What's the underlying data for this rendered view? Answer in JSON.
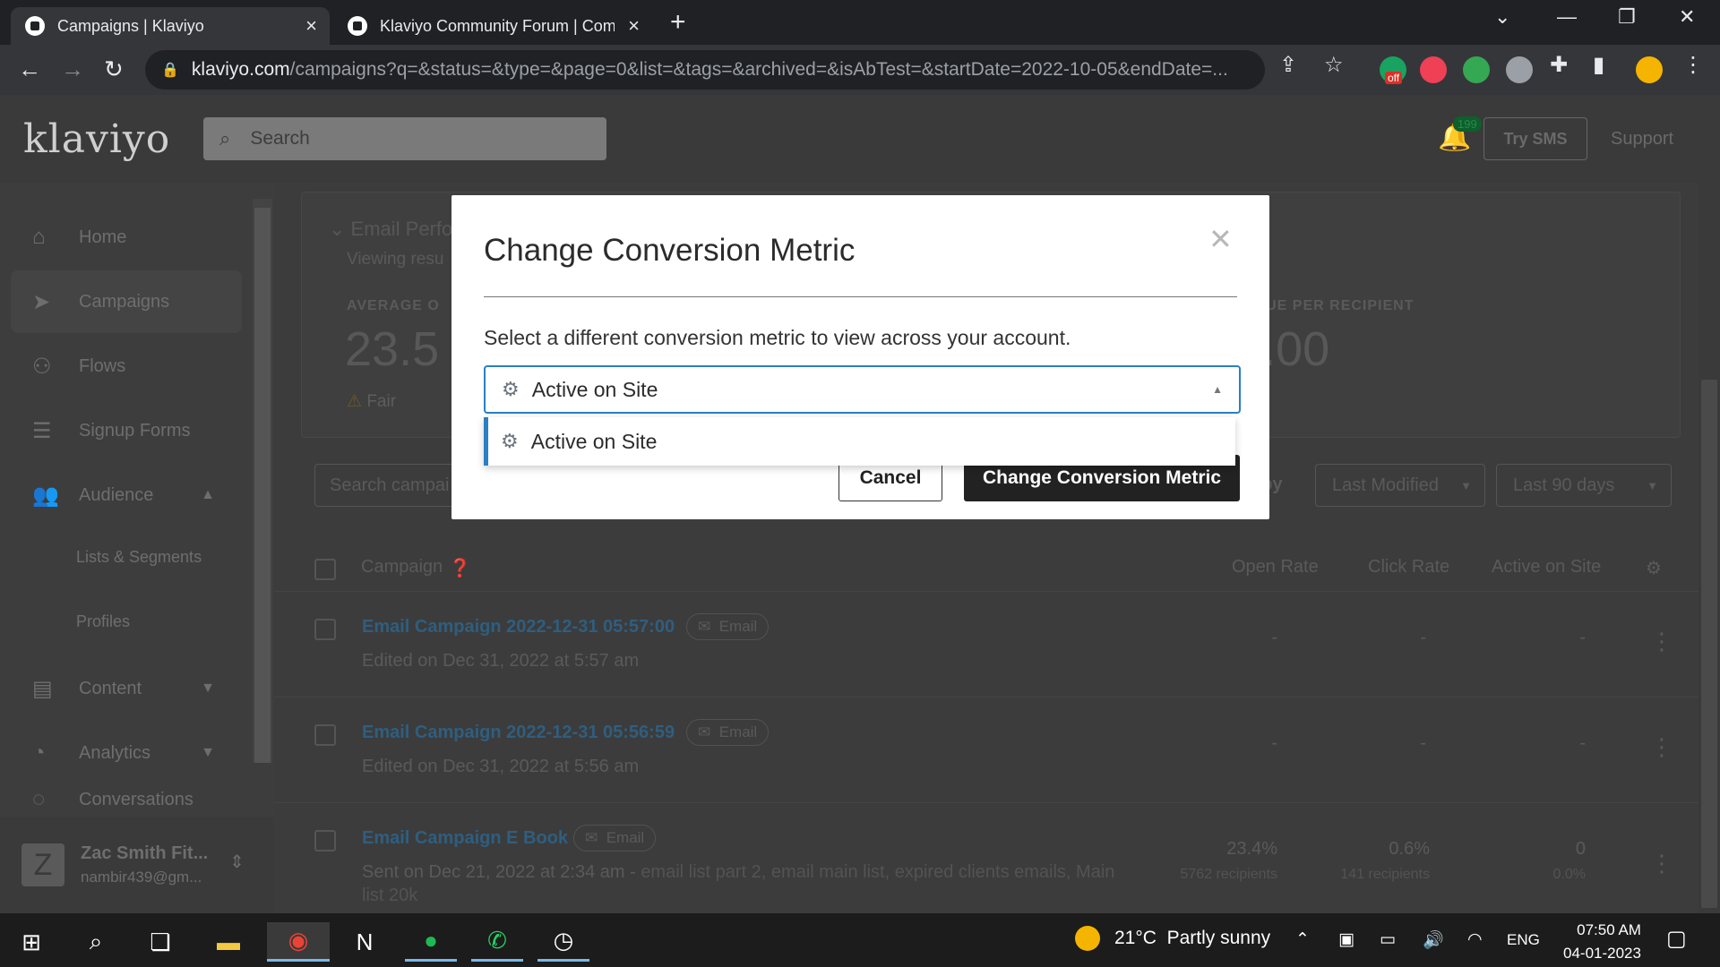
{
  "browser": {
    "tabs": [
      {
        "title": "Campaigns | Klaviyo",
        "active": true
      },
      {
        "title": "Klaviyo Community Forum | Com",
        "active": false
      }
    ],
    "url_host": "klaviyo.com",
    "url_path": "/campaigns?q=&status=&type=&page=0&list=&tags=&archived=&isAbTest=&startDate=2022-10-05&endDate=...",
    "extension_badge": "off"
  },
  "header": {
    "logo": "klaviyo",
    "search_placeholder": "Search",
    "notification_count": "199",
    "try_sms": "Try SMS",
    "support": "Support"
  },
  "sidebar": {
    "items": [
      {
        "label": "Home",
        "icon": "home-icon"
      },
      {
        "label": "Campaigns",
        "icon": "campaigns-icon",
        "active": true
      },
      {
        "label": "Flows",
        "icon": "flows-icon"
      },
      {
        "label": "Signup Forms",
        "icon": "signup-forms-icon"
      },
      {
        "label": "Audience",
        "icon": "audience-icon"
      },
      {
        "label": "Content",
        "icon": "content-icon"
      },
      {
        "label": "Analytics",
        "icon": "analytics-icon"
      },
      {
        "label": "Conversations",
        "icon": "conversations-icon"
      }
    ],
    "sub_items": [
      "Lists & Segments",
      "Profiles"
    ],
    "account": {
      "initial": "Z",
      "name": "Zac Smith Fit...",
      "email": "nambir439@gm..."
    }
  },
  "performance": {
    "title": "Email Perfo",
    "subtitle": "Viewing resu",
    "avg_label": "AVERAGE O",
    "avg_value": "23.5",
    "avg_note": "Fair",
    "rpr_label": "REVENUE PER RECIPIENT",
    "rpr_value": "$0.00"
  },
  "filters": {
    "search_placeholder": "Search campai",
    "sort_label": "t by",
    "sort_value": "Last Modified",
    "range_value": "Last 90 days"
  },
  "table": {
    "headers": {
      "campaign": "Campaign",
      "open_rate": "Open Rate",
      "click_rate": "Click Rate",
      "active_on_site": "Active on Site"
    },
    "rows": [
      {
        "name": "Email Campaign 2022-12-31 05:57:00",
        "tag": "Email",
        "sub": "Edited on Dec 31, 2022 at 5:57 am",
        "lists": "",
        "open": "-",
        "open_sub": "",
        "click": "-",
        "click_sub": "",
        "aos": "-",
        "aos_sub": ""
      },
      {
        "name": "Email Campaign 2022-12-31 05:56:59",
        "tag": "Email",
        "sub": "Edited on Dec 31, 2022 at 5:56 am",
        "lists": "",
        "open": "-",
        "open_sub": "",
        "click": "-",
        "click_sub": "",
        "aos": "-",
        "aos_sub": ""
      },
      {
        "name": "Email Campaign E Book",
        "tag": "Email",
        "sub": "Sent on Dec 21, 2022 at 2:34 am - ",
        "lists": "email list part 2, email main list, expired clients emails, Main list 20k",
        "open": "23.4%",
        "open_sub": "5762 recipients",
        "click": "0.6%",
        "click_sub": "141 recipients",
        "aos": "0",
        "aos_sub": "0.0%"
      }
    ]
  },
  "modal": {
    "title": "Change Conversion Metric",
    "description": "Select a different conversion metric to view across your account.",
    "selected": "Active on Site",
    "options": [
      "Active on Site"
    ],
    "cancel": "Cancel",
    "confirm": "Change Conversion Metric",
    "accent_color": "#2a7fc4"
  },
  "taskbar": {
    "weather_temp": "21°C",
    "weather_text": "Partly sunny",
    "language": "ENG",
    "time": "07:50 AM",
    "date": "04-01-2023"
  }
}
